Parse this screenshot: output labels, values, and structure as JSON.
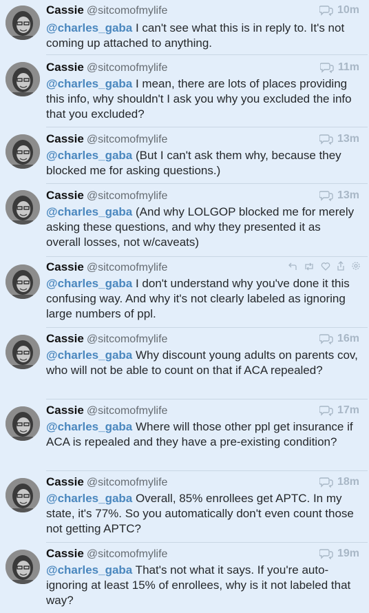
{
  "colors": {
    "background": "#e3eefa",
    "mention": "#4a87be",
    "timestamp": "#a8b7c6"
  },
  "tweets": [
    {
      "name": "Cassie",
      "handle": "@sitcomofmylife",
      "time": "10m",
      "mention": "@charles_gaba",
      "text": " I can't see what this is in reply to. It's not coming up attached to anything."
    },
    {
      "name": "Cassie",
      "handle": "@sitcomofmylife",
      "time": "11m",
      "mention": "@charles_gaba",
      "text": " I mean, there are lots of places providing this info, why shouldn't I ask you why you excluded the info that you excluded?"
    },
    {
      "name": "Cassie",
      "handle": "@sitcomofmylife",
      "time": "13m",
      "mention": "@charles_gaba",
      "text": " (But I can't ask them why, because they blocked me for asking questions.)"
    },
    {
      "name": "Cassie",
      "handle": "@sitcomofmylife",
      "time": "13m",
      "mention": "@charles_gaba",
      "text": " (And why LOLGOP blocked me for merely asking these questions, and why they presented it as overall losses, not w/caveats)"
    },
    {
      "name": "Cassie",
      "handle": "@sitcomofmylife",
      "time": "",
      "mention": "@charles_gaba",
      "text": " I don't understand why you've done it this confusing way. And why it's not clearly labeled as ignoring large numbers of ppl."
    },
    {
      "name": "Cassie",
      "handle": "@sitcomofmylife",
      "time": "16m",
      "mention": "@charles_gaba",
      "text": " Why discount young adults on parents cov, who will not be able to count on that if ACA repealed?"
    },
    {
      "name": "Cassie",
      "handle": "@sitcomofmylife",
      "time": "17m",
      "mention": "@charles_gaba",
      "text": " Where will those other ppl get insurance if ACA is repealed and they have a pre-existing condition?"
    },
    {
      "name": "Cassie",
      "handle": "@sitcomofmylife",
      "time": "18m",
      "mention": "@charles_gaba",
      "text": " Overall, 85% enrollees get APTC. In my state, it's 77%. So you automatically don't even count those not getting APTC?"
    },
    {
      "name": "Cassie",
      "handle": "@sitcomofmylife",
      "time": "19m",
      "mention": "@charles_gaba",
      "text": " That's not what it says. If you're auto-ignoring at least 15% of enrollees, why is it not labeled that way?"
    }
  ],
  "icons": {
    "conversation": "conversation-icon",
    "reply": "reply-icon",
    "retweet": "retweet-icon",
    "like": "heart-icon",
    "share": "share-icon",
    "settings": "gear-icon"
  }
}
